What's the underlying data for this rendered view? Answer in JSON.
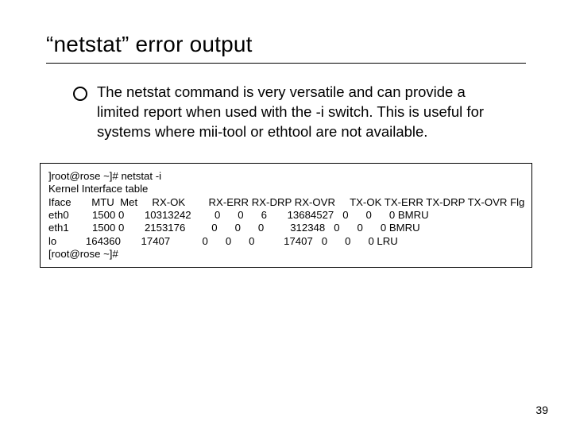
{
  "title": "“netstat” error output",
  "paragraph": "The netstat command is very versatile and can provide a limited report when used with the -i switch. This is useful for systems where mii-tool or ethtool are not available.",
  "code": "]root@rose ~]# netstat -i\nKernel Interface table\nIface       MTU  Met     RX-OK        RX-ERR RX-DRP RX-OVR     TX-OK TX-ERR TX-DRP TX-OVR Flg\neth0        1500 0       10313242        0      0      6       13684527   0      0      0 BMRU\neth1        1500 0       2153176         0      0      0         312348   0      0      0 BMRU\nlo          164360       17407           0      0      0          17407   0      0      0 LRU\n[root@rose ~]#",
  "page_number": "39"
}
